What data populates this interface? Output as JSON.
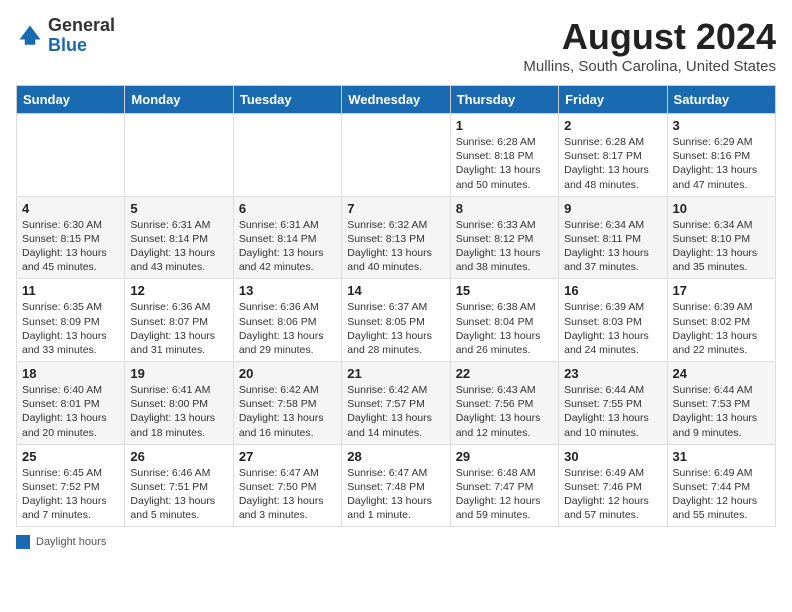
{
  "logo": {
    "text_general": "General",
    "text_blue": "Blue"
  },
  "header": {
    "title": "August 2024",
    "location": "Mullins, South Carolina, United States"
  },
  "weekdays": [
    "Sunday",
    "Monday",
    "Tuesday",
    "Wednesday",
    "Thursday",
    "Friday",
    "Saturday"
  ],
  "weeks": [
    [
      {
        "day": "",
        "info": ""
      },
      {
        "day": "",
        "info": ""
      },
      {
        "day": "",
        "info": ""
      },
      {
        "day": "",
        "info": ""
      },
      {
        "day": "1",
        "info": "Sunrise: 6:28 AM\nSunset: 8:18 PM\nDaylight: 13 hours\nand 50 minutes."
      },
      {
        "day": "2",
        "info": "Sunrise: 6:28 AM\nSunset: 8:17 PM\nDaylight: 13 hours\nand 48 minutes."
      },
      {
        "day": "3",
        "info": "Sunrise: 6:29 AM\nSunset: 8:16 PM\nDaylight: 13 hours\nand 47 minutes."
      }
    ],
    [
      {
        "day": "4",
        "info": "Sunrise: 6:30 AM\nSunset: 8:15 PM\nDaylight: 13 hours\nand 45 minutes."
      },
      {
        "day": "5",
        "info": "Sunrise: 6:31 AM\nSunset: 8:14 PM\nDaylight: 13 hours\nand 43 minutes."
      },
      {
        "day": "6",
        "info": "Sunrise: 6:31 AM\nSunset: 8:14 PM\nDaylight: 13 hours\nand 42 minutes."
      },
      {
        "day": "7",
        "info": "Sunrise: 6:32 AM\nSunset: 8:13 PM\nDaylight: 13 hours\nand 40 minutes."
      },
      {
        "day": "8",
        "info": "Sunrise: 6:33 AM\nSunset: 8:12 PM\nDaylight: 13 hours\nand 38 minutes."
      },
      {
        "day": "9",
        "info": "Sunrise: 6:34 AM\nSunset: 8:11 PM\nDaylight: 13 hours\nand 37 minutes."
      },
      {
        "day": "10",
        "info": "Sunrise: 6:34 AM\nSunset: 8:10 PM\nDaylight: 13 hours\nand 35 minutes."
      }
    ],
    [
      {
        "day": "11",
        "info": "Sunrise: 6:35 AM\nSunset: 8:09 PM\nDaylight: 13 hours\nand 33 minutes."
      },
      {
        "day": "12",
        "info": "Sunrise: 6:36 AM\nSunset: 8:07 PM\nDaylight: 13 hours\nand 31 minutes."
      },
      {
        "day": "13",
        "info": "Sunrise: 6:36 AM\nSunset: 8:06 PM\nDaylight: 13 hours\nand 29 minutes."
      },
      {
        "day": "14",
        "info": "Sunrise: 6:37 AM\nSunset: 8:05 PM\nDaylight: 13 hours\nand 28 minutes."
      },
      {
        "day": "15",
        "info": "Sunrise: 6:38 AM\nSunset: 8:04 PM\nDaylight: 13 hours\nand 26 minutes."
      },
      {
        "day": "16",
        "info": "Sunrise: 6:39 AM\nSunset: 8:03 PM\nDaylight: 13 hours\nand 24 minutes."
      },
      {
        "day": "17",
        "info": "Sunrise: 6:39 AM\nSunset: 8:02 PM\nDaylight: 13 hours\nand 22 minutes."
      }
    ],
    [
      {
        "day": "18",
        "info": "Sunrise: 6:40 AM\nSunset: 8:01 PM\nDaylight: 13 hours\nand 20 minutes."
      },
      {
        "day": "19",
        "info": "Sunrise: 6:41 AM\nSunset: 8:00 PM\nDaylight: 13 hours\nand 18 minutes."
      },
      {
        "day": "20",
        "info": "Sunrise: 6:42 AM\nSunset: 7:58 PM\nDaylight: 13 hours\nand 16 minutes."
      },
      {
        "day": "21",
        "info": "Sunrise: 6:42 AM\nSunset: 7:57 PM\nDaylight: 13 hours\nand 14 minutes."
      },
      {
        "day": "22",
        "info": "Sunrise: 6:43 AM\nSunset: 7:56 PM\nDaylight: 13 hours\nand 12 minutes."
      },
      {
        "day": "23",
        "info": "Sunrise: 6:44 AM\nSunset: 7:55 PM\nDaylight: 13 hours\nand 10 minutes."
      },
      {
        "day": "24",
        "info": "Sunrise: 6:44 AM\nSunset: 7:53 PM\nDaylight: 13 hours\nand 9 minutes."
      }
    ],
    [
      {
        "day": "25",
        "info": "Sunrise: 6:45 AM\nSunset: 7:52 PM\nDaylight: 13 hours\nand 7 minutes."
      },
      {
        "day": "26",
        "info": "Sunrise: 6:46 AM\nSunset: 7:51 PM\nDaylight: 13 hours\nand 5 minutes."
      },
      {
        "day": "27",
        "info": "Sunrise: 6:47 AM\nSunset: 7:50 PM\nDaylight: 13 hours\nand 3 minutes."
      },
      {
        "day": "28",
        "info": "Sunrise: 6:47 AM\nSunset: 7:48 PM\nDaylight: 13 hours\nand 1 minute."
      },
      {
        "day": "29",
        "info": "Sunrise: 6:48 AM\nSunset: 7:47 PM\nDaylight: 12 hours\nand 59 minutes."
      },
      {
        "day": "30",
        "info": "Sunrise: 6:49 AM\nSunset: 7:46 PM\nDaylight: 12 hours\nand 57 minutes."
      },
      {
        "day": "31",
        "info": "Sunrise: 6:49 AM\nSunset: 7:44 PM\nDaylight: 12 hours\nand 55 minutes."
      }
    ]
  ],
  "footer": {
    "label": "Daylight hours"
  }
}
